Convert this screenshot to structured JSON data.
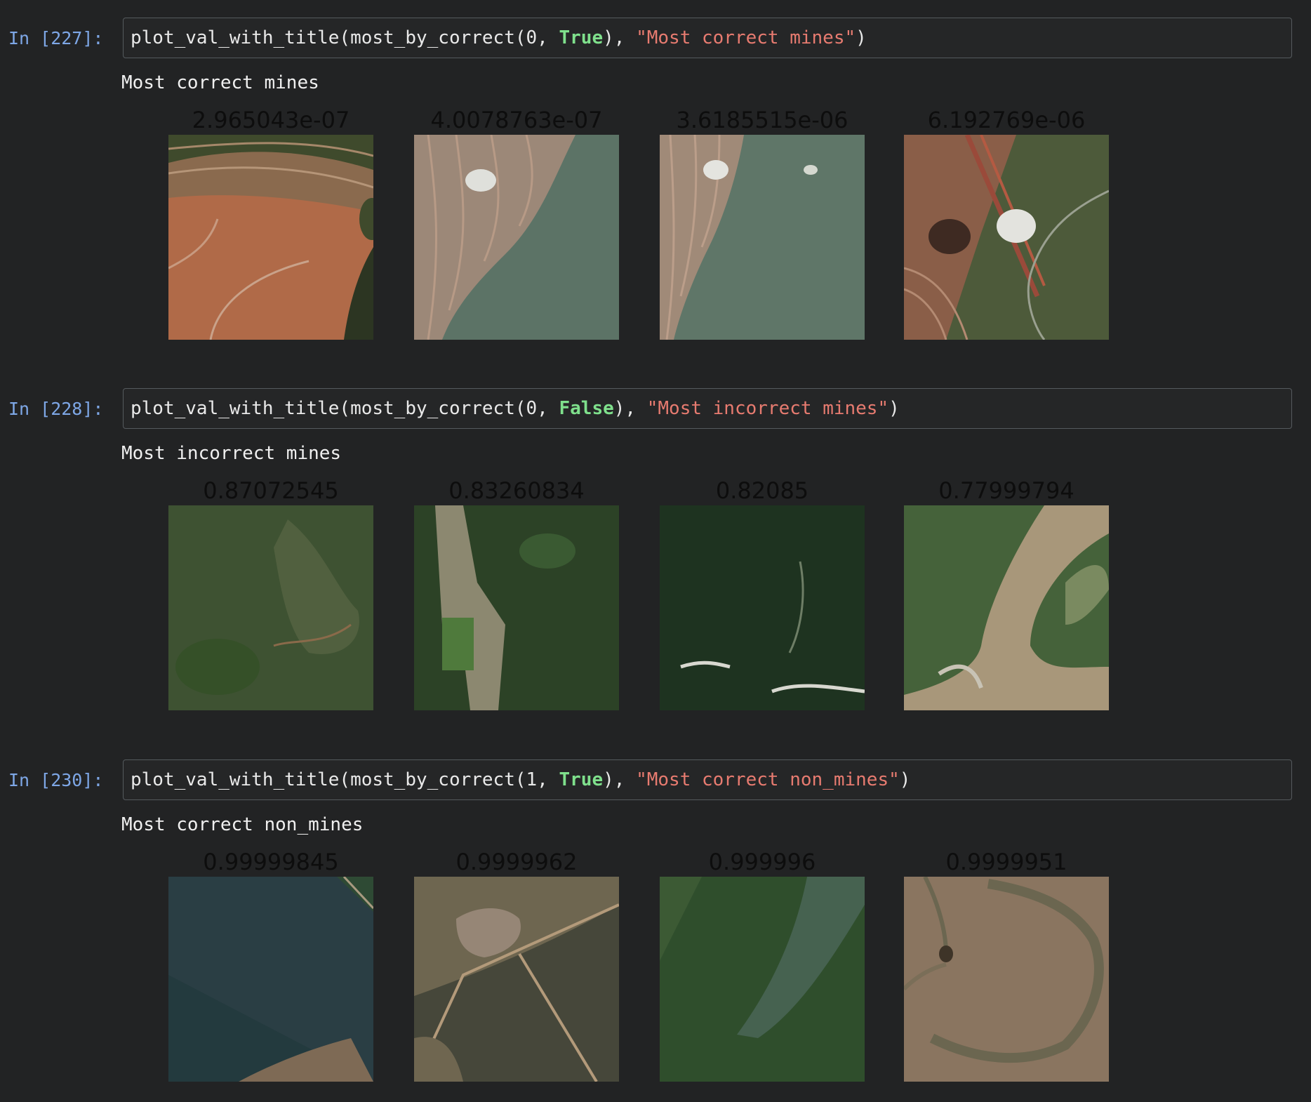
{
  "cells": [
    {
      "prompt": "In [227]:",
      "code": {
        "fn": "plot_val_with_title(most_by_correct(0, ",
        "kw": "True",
        "mid": "), ",
        "str": "\"Most correct mines\"",
        "end": ")"
      },
      "output_title": "Most correct mines",
      "tiles": [
        {
          "label": "2.965043e-07",
          "image": "open-pit-mine-red-soil"
        },
        {
          "label": "4.0078763e-07",
          "image": "terraced-mine-edge-forest"
        },
        {
          "label": "3.6185515e-06",
          "image": "mine-terraces-haze"
        },
        {
          "label": "6.192769e-06",
          "image": "mine-railway-smoke"
        }
      ]
    },
    {
      "prompt": "In [228]:",
      "code": {
        "fn": "plot_val_with_title(most_by_correct(0, ",
        "kw": "False",
        "mid": "), ",
        "str": "\"Most incorrect mines\"",
        "end": ")"
      },
      "output_title": "Most incorrect mines",
      "tiles": [
        {
          "label": "0.87072545",
          "image": "forest-muddy-lake"
        },
        {
          "label": "0.83260834",
          "image": "forest-cleared-strip"
        },
        {
          "label": "0.82085",
          "image": "dense-forest-river"
        },
        {
          "label": "0.77999794",
          "image": "muddy-river-sandbars"
        }
      ]
    },
    {
      "prompt": "In [230]:",
      "code": {
        "fn": "plot_val_with_title(most_by_correct(1, ",
        "kw": "True",
        "mid": "), ",
        "str": "\"Most correct non_mines\"",
        "end": ")"
      },
      "output_title": "Most correct non_mines",
      "tiles": [
        {
          "label": "0.99999845",
          "image": "dark-river-diagonal"
        },
        {
          "label": "0.9999962",
          "image": "forest-roads-clearing"
        },
        {
          "label": "0.999996",
          "image": "forest-river-band"
        },
        {
          "label": "0.9999951",
          "image": "dry-pasture-oxbow"
        }
      ]
    }
  ],
  "colors": {
    "background": "#222324",
    "prompt": "#7ea7e6",
    "keyword": "#7fe08c",
    "string": "#e77b70"
  }
}
